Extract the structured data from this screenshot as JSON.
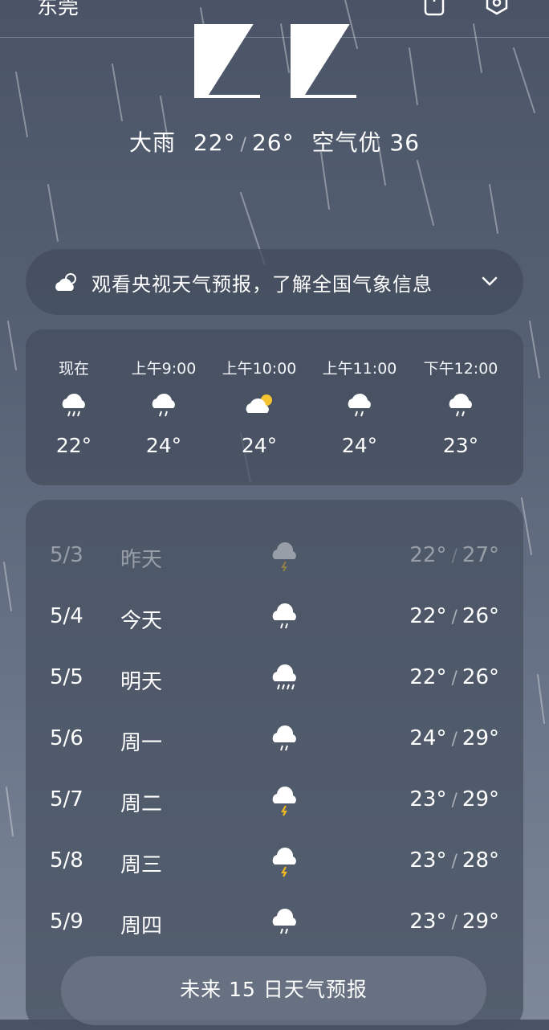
{
  "header": {
    "city": "东莞",
    "icons": [
      "phone-icon",
      "settings-icon"
    ]
  },
  "current": {
    "temp": "22",
    "condition": "大雨",
    "low": "22°",
    "high": "26°",
    "air": "空气优 36"
  },
  "banner": {
    "text": "观看央视天气预报，了解全国气象信息",
    "icon": "cloudy-sun-icon"
  },
  "hourly": [
    {
      "time": "现在",
      "temp": "22°",
      "icon": "rain-cloud-icon"
    },
    {
      "time": "上午9:00",
      "temp": "24°",
      "icon": "rain-cloud-icon"
    },
    {
      "time": "上午10:00",
      "temp": "24°",
      "icon": "partly-cloudy-icon"
    },
    {
      "time": "上午11:00",
      "temp": "24°",
      "icon": "rain-cloud-icon"
    },
    {
      "time": "下午12:00",
      "temp": "23°",
      "icon": "rain-cloud-icon"
    }
  ],
  "daily": [
    {
      "date": "5/3",
      "label": "昨天",
      "low": "22°",
      "high": "27°",
      "icon": "thunder-cloud-icon",
      "past": true
    },
    {
      "date": "5/4",
      "label": "今天",
      "low": "22°",
      "high": "26°",
      "icon": "rain-cloud-icon"
    },
    {
      "date": "5/5",
      "label": "明天",
      "low": "22°",
      "high": "26°",
      "icon": "heavy-rain-cloud-icon"
    },
    {
      "date": "5/6",
      "label": "周一",
      "low": "24°",
      "high": "29°",
      "icon": "rain-cloud-icon"
    },
    {
      "date": "5/7",
      "label": "周二",
      "low": "23°",
      "high": "29°",
      "icon": "thunder-cloud-icon"
    },
    {
      "date": "5/8",
      "label": "周三",
      "low": "23°",
      "high": "28°",
      "icon": "thunder-cloud-icon"
    },
    {
      "date": "5/9",
      "label": "周四",
      "low": "23°",
      "high": "29°",
      "icon": "rain-cloud-icon"
    }
  ],
  "forecast_button": "未来 15 日天气预报",
  "colors": {
    "accent_sun": "#f5c430",
    "bolt": "#f2b820"
  }
}
